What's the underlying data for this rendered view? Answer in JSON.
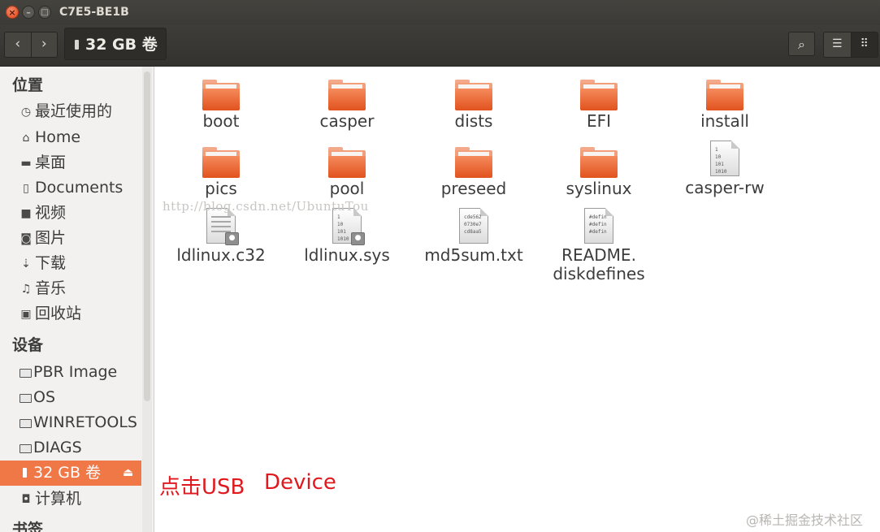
{
  "window": {
    "title": "C7E5-BE1B",
    "controls": {
      "close": "×",
      "minimize": "–",
      "maximize": "□"
    }
  },
  "toolbar": {
    "back_icon": "‹",
    "forward_icon": "›",
    "path_label": "32 GB 卷",
    "search_icon": "⌕",
    "list_view_icon": "☰",
    "grid_view_icon": "⠿"
  },
  "sidebar": {
    "places_heading": "位置",
    "places": [
      {
        "label": "最近使用的",
        "icon": "clock-icon",
        "glyph": "◷"
      },
      {
        "label": "Home",
        "icon": "home-icon",
        "glyph": "⌂"
      },
      {
        "label": "桌面",
        "icon": "folder-icon",
        "glyph": "▬"
      },
      {
        "label": "Documents",
        "icon": "document-icon",
        "glyph": "▯"
      },
      {
        "label": "视频",
        "icon": "video-icon",
        "glyph": "■"
      },
      {
        "label": "图片",
        "icon": "camera-icon",
        "glyph": "◙"
      },
      {
        "label": "下载",
        "icon": "download-icon",
        "glyph": "⇣"
      },
      {
        "label": "音乐",
        "icon": "music-icon",
        "glyph": "♫"
      },
      {
        "label": "回收站",
        "icon": "trash-icon",
        "glyph": "▣"
      }
    ],
    "devices_heading": "设备",
    "devices": [
      {
        "label": "PBR Image",
        "icon": "drive-icon"
      },
      {
        "label": "OS",
        "icon": "drive-icon"
      },
      {
        "label": "WINRETOOLS",
        "icon": "drive-icon"
      },
      {
        "label": "DIAGS",
        "icon": "drive-icon"
      }
    ],
    "selected_device": {
      "label": "32 GB 卷",
      "icon": "usb-icon",
      "eject_icon": "⏏"
    },
    "computer": {
      "label": "计算机",
      "icon": "computer-icon",
      "glyph": "◘"
    },
    "bookmarks_heading": "书签"
  },
  "files": [
    {
      "name": "boot",
      "type": "folder"
    },
    {
      "name": "casper",
      "type": "folder"
    },
    {
      "name": "dists",
      "type": "folder"
    },
    {
      "name": "EFI",
      "type": "folder"
    },
    {
      "name": "install",
      "type": "folder"
    },
    {
      "name": "pics",
      "type": "folder"
    },
    {
      "name": "pool",
      "type": "folder"
    },
    {
      "name": "preseed",
      "type": "folder"
    },
    {
      "name": "syslinux",
      "type": "folder"
    },
    {
      "name": "casper-rw",
      "type": "binary",
      "preview": "1\n10\n101\n1010"
    },
    {
      "name": "ldlinux.c32",
      "type": "locked-text"
    },
    {
      "name": "ldlinux.sys",
      "type": "locked-binary",
      "preview": "1\n10\n101\n1010"
    },
    {
      "name": "md5sum.txt",
      "type": "text",
      "preview": "cde562\n0730e7\ncd8aa5"
    },
    {
      "name": "README.\ndiskdefines",
      "line1": "README.",
      "line2": "diskdefines",
      "type": "text",
      "preview": "#defin\n#defin\n#defin"
    }
  ],
  "annotation": {
    "text1": "点击USB",
    "text2": "Device",
    "color": "#e0191e"
  },
  "watermark": "http://blog.csdn.net/UbuntuTou",
  "corner_watermark": "@稀土掘金技术社区",
  "colors": {
    "accent": "#f07746",
    "folder_orange": "#e1531e",
    "titlebar": "#3b3a36"
  }
}
